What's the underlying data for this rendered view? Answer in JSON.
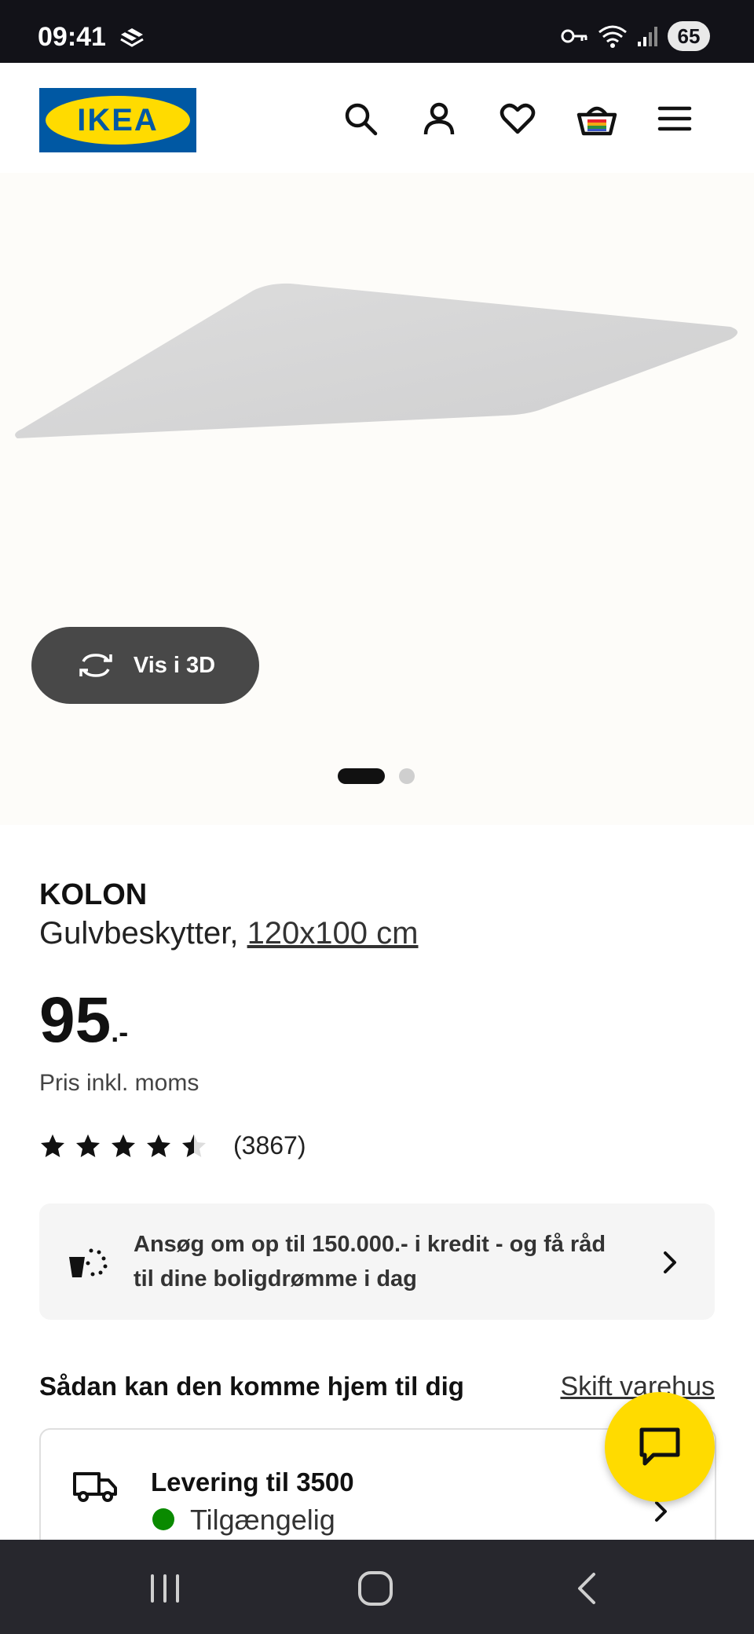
{
  "status_bar": {
    "time": "09:41",
    "battery": "65",
    "icons": [
      "app-notification-icon",
      "key-icon",
      "wifi-icon",
      "signal-icon"
    ]
  },
  "header": {
    "logo_text": "IKEA",
    "icons": [
      "search-icon",
      "account-icon",
      "heart-icon",
      "basket-icon",
      "menu-icon"
    ],
    "colors": {
      "logo_blue": "#0058a3",
      "logo_yellow": "#ffdb00"
    }
  },
  "gallery": {
    "view_3d_label": "Vis i 3D",
    "pages": 2,
    "active_page": 1
  },
  "product": {
    "name": "KOLON",
    "type": "Gulvbeskytter,",
    "size": "120x100 cm",
    "price": "95",
    "price_suffix": ".-",
    "price_note": "Pris inkl. moms",
    "rating": 4.5,
    "rating_max": 5,
    "reviews": "(3867)"
  },
  "credit_banner": {
    "text": "Ansøg om op til 150.000.- i kredit - og få råd til dine boligdrømme i dag"
  },
  "delivery": {
    "heading": "Sådan kan den komme hjem til dig",
    "change_store": "Skift varehus",
    "option_title": "Levering til 3500",
    "availability": "Tilgængelig",
    "availability_color": "#0a8a00"
  },
  "chat": {
    "color": "#ffdb00"
  },
  "nav_bar": {
    "buttons": [
      "recents-button",
      "home-button",
      "back-button"
    ]
  }
}
